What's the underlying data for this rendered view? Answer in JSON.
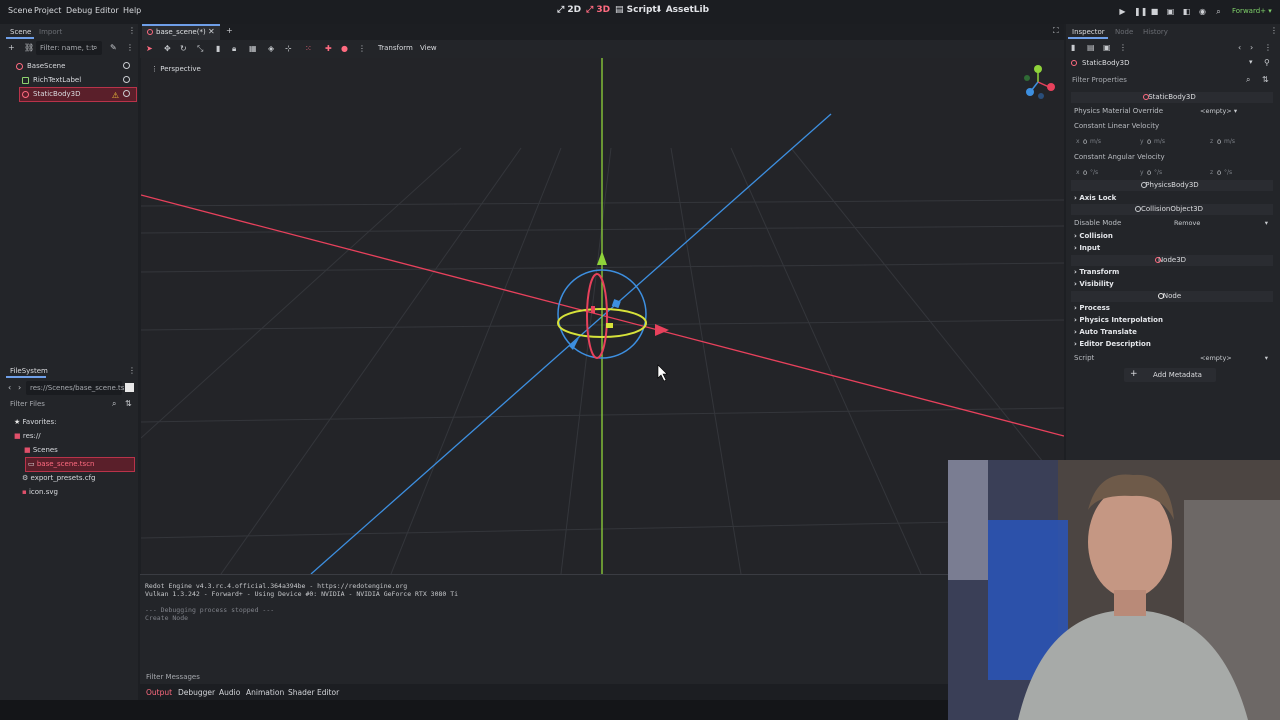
{
  "menu": [
    "Scene",
    "Project",
    "Debug",
    "Editor",
    "Help"
  ],
  "workspaces": {
    "w2d": "2D",
    "w3d": "3D",
    "script": "Script",
    "assetlib": "AssetLib"
  },
  "renderer": "Forward+",
  "scene_dock": {
    "tabs": [
      "Scene",
      "Import"
    ],
    "filter_placeholder": "Filter: name, t:t",
    "nodes": [
      {
        "label": "BaseScene",
        "icon": "node3d-icon"
      },
      {
        "label": "RichTextLabel",
        "icon": "richtextlabel-icon"
      },
      {
        "label": "StaticBody3D",
        "icon": "staticbody3d-icon",
        "warning": true
      }
    ]
  },
  "filesystem": {
    "title": "FileSystem",
    "path": "res://Scenes/base_scene.ts",
    "filter_placeholder": "Filter Files",
    "items": [
      {
        "label": "Favorites:",
        "icon": "star-icon"
      },
      {
        "label": "res://",
        "icon": "folder-icon"
      },
      {
        "label": "Scenes",
        "icon": "folder-icon"
      },
      {
        "label": "base_scene.tscn",
        "icon": "scene-file-icon",
        "selected": true
      },
      {
        "label": "export_presets.cfg",
        "icon": "config-file-icon"
      },
      {
        "label": "icon.svg",
        "icon": "image-file-icon"
      }
    ]
  },
  "editor_tab": {
    "label": "base_scene(*)"
  },
  "viewport": {
    "toolbar_menus": [
      "Transform",
      "View"
    ],
    "perspective_label": "Perspective"
  },
  "inspector": {
    "tabs": [
      "Inspector",
      "Node",
      "History"
    ],
    "object_name": "StaticBody3D",
    "filter_placeholder": "Filter Properties",
    "class_static": "StaticBody3D",
    "physics_material_label": "Physics Material Override",
    "physics_material_value": "<empty>",
    "linear_velocity_label": "Constant Linear Velocity",
    "angular_velocity_label": "Constant Angular Velocity",
    "linear_velocity": {
      "x": "0",
      "y": "0",
      "z": "0",
      "unit": "m/s"
    },
    "angular_velocity": {
      "x": "0",
      "y": "0",
      "z": "0",
      "unit": "°/s"
    },
    "axis_labels": {
      "x": "x",
      "y": "y",
      "z": "z"
    },
    "class_physicsbody": "PhysicsBody3D",
    "axis_lock": "Axis Lock",
    "class_collisionobject": "CollisionObject3D",
    "disable_mode_label": "Disable Mode",
    "disable_mode_value": "Remove",
    "collision": "Collision",
    "input": "Input",
    "class_node3d": "Node3D",
    "transform": "Transform",
    "visibility": "Visibility",
    "class_node": "Node",
    "process": "Process",
    "physics_interpolation": "Physics Interpolation",
    "auto_translate": "Auto Translate",
    "editor_description": "Editor Description",
    "script_label": "Script",
    "script_value": "<empty>",
    "add_metadata": "Add Metadata"
  },
  "output": {
    "lines": [
      "Redot Engine v4.3.rc.4.official.364a394be - https://redotengine.org",
      "Vulkan 1.3.242 - Forward+ - Using Device #0: NVIDIA - NVIDIA GeForce RTX 3080 Ti",
      "",
      "--- Debugging process stopped ---",
      "Create Node"
    ],
    "filter_placeholder": "Filter Messages",
    "tabs": [
      "Output",
      "Debugger",
      "Audio",
      "Animation",
      "Shader Editor"
    ]
  },
  "colors": {
    "accent": "#ff6b80",
    "x_axis": "#e8415c",
    "y_axis": "#8fd33a",
    "z_axis": "#3d8fe0"
  }
}
